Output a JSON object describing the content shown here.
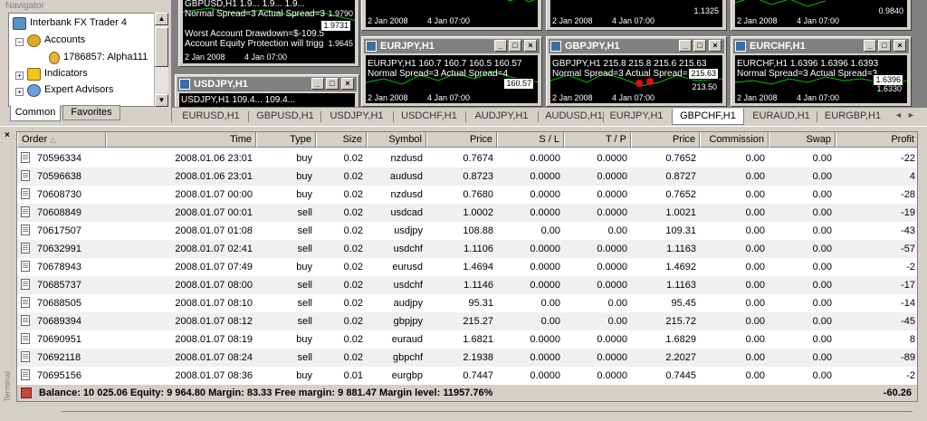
{
  "navigator": {
    "title": "Navigator",
    "items": [
      {
        "label": "Interbank FX Trader 4",
        "icon": "terminal-icon"
      },
      {
        "label": "Accounts",
        "icon": "accounts-icon"
      },
      {
        "label": "1786857: Alpha111",
        "icon": "user-icon"
      },
      {
        "label": "Indicators",
        "icon": "indicators-icon"
      },
      {
        "label": "Expert Advisors",
        "icon": "experts-icon"
      }
    ],
    "tabs": [
      "Common",
      "Favorites"
    ]
  },
  "charts": [
    {
      "title": "",
      "lines": [
        "GBPUSD,H1  1.9... 1.9... 1.9...",
        "Normal Spread=3 Actual Spread=3",
        "Worst Account Drawdown=$-109.5",
        "Account Equity Protection will trigg"
      ],
      "prices": [
        "1.9790",
        "1.9731",
        "1.9645"
      ],
      "dates": [
        "2 Jan 2008",
        "4 Jan 07:00"
      ]
    },
    {
      "title": "",
      "lines": [],
      "prices": [],
      "dates": [
        "2 Jan 2008",
        "4 Jan 07:00"
      ]
    },
    {
      "title": "",
      "lines": [],
      "prices": [
        "1.1325"
      ],
      "dates": [
        "2 Jan 2008",
        "4 Jan 07:00"
      ]
    },
    {
      "title": "",
      "lines": [],
      "prices": [
        "0.9840"
      ],
      "dates": [
        "2 Jan 2008",
        "4 Jan 07:00"
      ]
    },
    {
      "title": "USDJPY,H1",
      "lines": [
        "USDJPY,H1 109.4... 109.4..."
      ],
      "prices": [],
      "dates": []
    },
    {
      "title": "EURJPY,H1",
      "lines": [
        "EURJPY,H1  160.7  160.7  160.5  160.57",
        "Normal Spread=3 Actual Spread=4"
      ],
      "prices": [
        "160.57"
      ],
      "dates": [
        "2 Jan 2008",
        "4 Jan 07:00"
      ]
    },
    {
      "title": "GBPJPY,H1",
      "lines": [
        "GBPJPY,H1  215.8  215.8  215.6  215.63",
        "Normal Spread=3 Actual Spread="
      ],
      "prices": [
        "215.63",
        "213.50"
      ],
      "dates": [
        "2 Jan 2008",
        "4 Jan 07:00"
      ]
    },
    {
      "title": "EURCHF,H1",
      "lines": [
        "EURCHF,H1  1.6396  1.6396  1.6393",
        "Normal Spread=3 Actual Spread=3"
      ],
      "prices": [
        "1.6396",
        "1.6330"
      ],
      "dates": [
        "2 Jan 2008",
        "4 Jan 07:00"
      ]
    }
  ],
  "symbol_tabs": [
    "EURUSD,H1",
    "GBPUSD,H1",
    "USDJPY,H1",
    "USDCHF,H1",
    "AUDJPY,H1",
    "AUDUSD,H1",
    "EURJPY,H1",
    "GBPCHF,H1",
    "EURAUD,H1",
    "EURGBP,H1"
  ],
  "symbol_tabs_active": "GBPCHF,H1",
  "terminal": {
    "side_label": "Terminal",
    "columns": [
      "Order",
      "Time",
      "Type",
      "Size",
      "Symbol",
      "Price",
      "S / L",
      "T / P",
      "Price",
      "Commission",
      "Swap",
      "Profit"
    ],
    "rows": [
      [
        "70596334",
        "2008.01.06 23:01",
        "buy",
        "0.02",
        "nzdusd",
        "0.7674",
        "0.0000",
        "0.0000",
        "0.7652",
        "0.00",
        "0.00",
        "-22"
      ],
      [
        "70596638",
        "2008.01.06 23:01",
        "buy",
        "0.02",
        "audusd",
        "0.8723",
        "0.0000",
        "0.0000",
        "0.8727",
        "0.00",
        "0.00",
        "4"
      ],
      [
        "70608730",
        "2008.01.07 00:00",
        "buy",
        "0.02",
        "nzdusd",
        "0.7680",
        "0.0000",
        "0.0000",
        "0.7652",
        "0.00",
        "0.00",
        "-28"
      ],
      [
        "70608849",
        "2008.01.07 00:01",
        "sell",
        "0.02",
        "usdcad",
        "1.0002",
        "0.0000",
        "0.0000",
        "1.0021",
        "0.00",
        "0.00",
        "-19"
      ],
      [
        "70617507",
        "2008.01.07 01:08",
        "sell",
        "0.02",
        "usdjpy",
        "108.88",
        "0.00",
        "0.00",
        "109.31",
        "0.00",
        "0.00",
        "-43"
      ],
      [
        "70632991",
        "2008.01.07 02:41",
        "sell",
        "0.02",
        "usdchf",
        "1.1106",
        "0.0000",
        "0.0000",
        "1.1163",
        "0.00",
        "0.00",
        "-57"
      ],
      [
        "70678943",
        "2008.01.07 07:49",
        "buy",
        "0.02",
        "eurusd",
        "1.4694",
        "0.0000",
        "0.0000",
        "1.4692",
        "0.00",
        "0.00",
        "-2"
      ],
      [
        "70685737",
        "2008.01.07 08:00",
        "sell",
        "0.02",
        "usdchf",
        "1.1146",
        "0.0000",
        "0.0000",
        "1.1163",
        "0.00",
        "0.00",
        "-17"
      ],
      [
        "70688505",
        "2008.01.07 08:10",
        "sell",
        "0.02",
        "audjpy",
        "95.31",
        "0.00",
        "0.00",
        "95.45",
        "0.00",
        "0.00",
        "-14"
      ],
      [
        "70689394",
        "2008.01.07 08:12",
        "sell",
        "0.02",
        "gbpjpy",
        "215.27",
        "0.00",
        "0.00",
        "215.72",
        "0.00",
        "0.00",
        "-45"
      ],
      [
        "70690951",
        "2008.01.07 08:19",
        "buy",
        "0.02",
        "euraud",
        "1.6821",
        "0.0000",
        "0.0000",
        "1.6829",
        "0.00",
        "0.00",
        "8"
      ],
      [
        "70692118",
        "2008.01.07 08:24",
        "sell",
        "0.02",
        "gbpchf",
        "2.1938",
        "0.0000",
        "0.0000",
        "2.2027",
        "0.00",
        "0.00",
        "-89"
      ],
      [
        "70695156",
        "2008.01.07 08:36",
        "buy",
        "0.01",
        "eurgbp",
        "0.7447",
        "0.0000",
        "0.0000",
        "0.7445",
        "0.00",
        "0.00",
        "-2"
      ]
    ],
    "summary": "Balance: 10 025.06  Equity: 9 964.80  Margin: 83.33  Free margin: 9 881.47  Margin level: 11957.76%",
    "total_profit": "-60.26"
  }
}
